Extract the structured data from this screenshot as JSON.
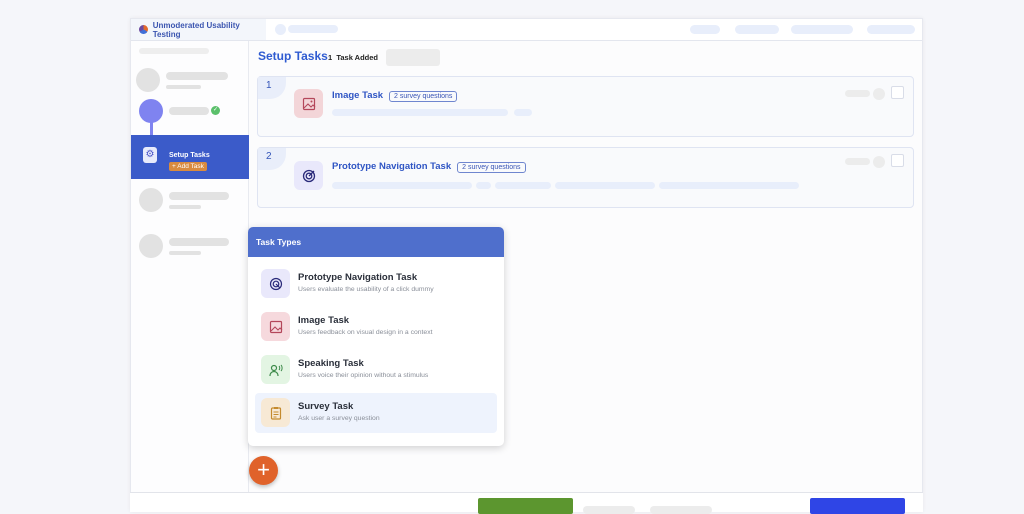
{
  "app": {
    "title": "Unmoderated Usability Testing"
  },
  "sidebar": {
    "active_step": {
      "label": "Setup Tasks",
      "action": "+ Add Task"
    }
  },
  "main": {
    "title": "Setup Tasks",
    "task_count": "1",
    "task_count_label": "Task Added",
    "tasks": [
      {
        "number": "1",
        "name": "Image Task",
        "badge": "2 survey questions",
        "icon": "image-icon"
      },
      {
        "number": "2",
        "name": "Prototype Navigation Task",
        "badge": "2 survey questions",
        "icon": "target-icon"
      }
    ]
  },
  "task_types": {
    "title": "Task Types",
    "items": [
      {
        "name": "Prototype Navigation Task",
        "description": "Users evaluate the usability of a click dummy",
        "icon": "target-icon",
        "color": "#e9e8fb"
      },
      {
        "name": "Image Task",
        "description": "Users feedback on visual design in a context",
        "icon": "image-icon",
        "color": "#f6d9dd"
      },
      {
        "name": "Speaking Task",
        "description": "Users voice their opinion without a stimulus",
        "icon": "speaking-person-icon",
        "color": "#e3f5e3"
      },
      {
        "name": "Survey Task",
        "description": "Ask user a survey question",
        "icon": "clipboard-icon",
        "color": "#f7e9d5",
        "highlighted": true
      }
    ]
  },
  "colors": {
    "accent": "#3b5bc9",
    "fab": "#e0622a",
    "green_button": "#5c962f",
    "blue_button": "#2f45e6"
  }
}
